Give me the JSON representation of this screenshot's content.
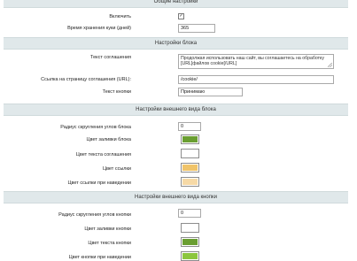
{
  "general": {
    "header": "Общие настройки",
    "enabled_label": "Включить",
    "enabled_mark": "✓",
    "cookie_days_label": "Время хранения куки (дней)",
    "cookie_days_value": "365"
  },
  "block": {
    "header": "Настройки блока",
    "agreement_text_label": "Текст соглашения",
    "agreement_text_value": "Продолжая использовать наш сайт, вы соглашаетесь на обработку [URL]файлов cookie[/URL]",
    "agreement_url_label": "Ссылка на страницу соглашения (URL):",
    "agreement_url_value": "/cookie/",
    "button_text_label": "Текст кнопки",
    "button_text_value": "Принимаю"
  },
  "block_appearance": {
    "header": "Настройки внешнего вида блока",
    "radius_label": "Радиус скругления углов блока",
    "radius_value": "0",
    "fill_label": "Цвет заливки блока",
    "fill_color": "#6a9e31",
    "text_color_label": "Цвет текста соглашения",
    "text_color": "#ffffff",
    "link_color_label": "Цвет ссылки",
    "link_color": "#f0c46a",
    "link_hover_label": "Цвет ссылки при наведении",
    "link_hover_color": "#f6d9a6"
  },
  "button_appearance": {
    "header": "Настройки внешнего вида кнопки",
    "radius_label": "Радиус скругления углов кнопки",
    "radius_value": "0",
    "fill_label": "Цвет заливки кнопки",
    "fill_color": "#ffffff",
    "text_color_label": "Цвет текста кнопки",
    "text_color": "#6a9e31",
    "hover_label": "Цвет кнопки при наведении",
    "hover_color": "#8cc63e"
  }
}
